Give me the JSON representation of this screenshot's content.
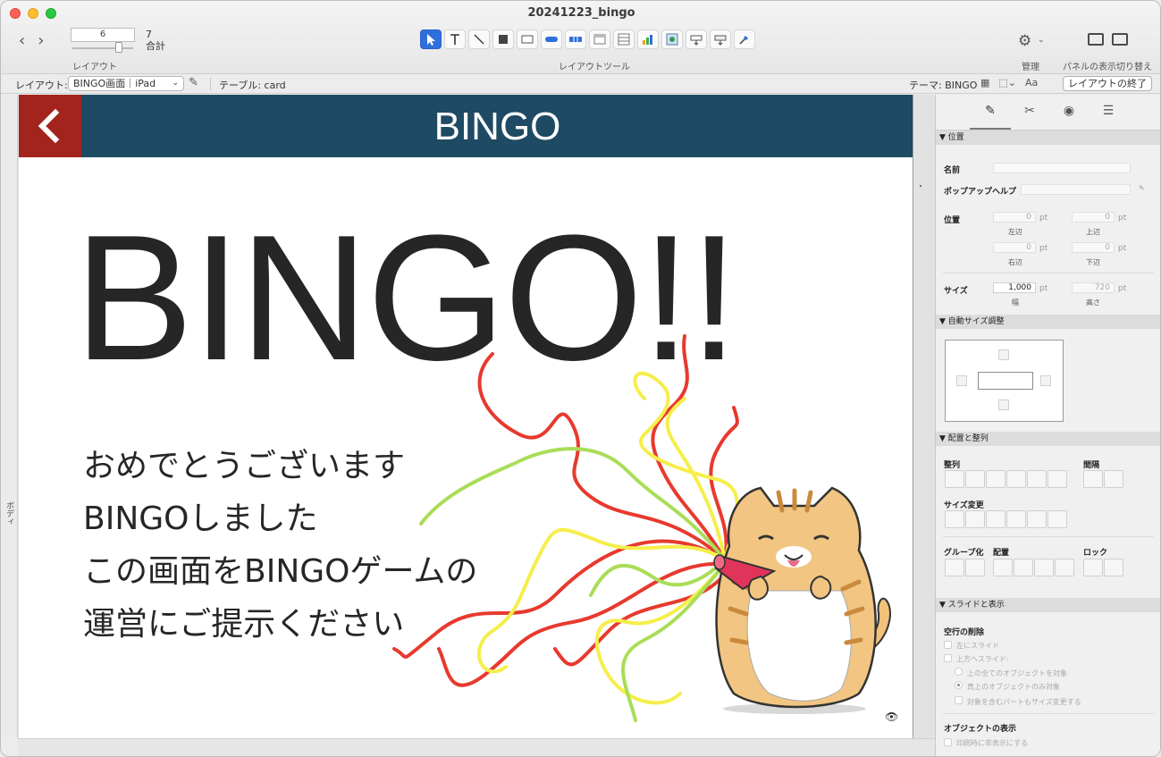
{
  "window": {
    "title": "20241223_bingo"
  },
  "toolbar": {
    "record_value": "6",
    "record_total": "7",
    "record_total_label": "合計",
    "layout_label": "レイアウト",
    "tools_label": "レイアウトツール",
    "manage_label": "管理",
    "panel_toggle_label": "パネルの表示切り替え",
    "tools": [
      "pointer-tool",
      "text-tool",
      "line-tool",
      "shape-tool",
      "field-tool",
      "button-tool",
      "button-bar-tool",
      "popover-tool",
      "portal-tool",
      "chart-tool",
      "web-viewer-tool",
      "insert-field-tool",
      "insert-part-tool",
      "format-painter-tool"
    ]
  },
  "layoutbar": {
    "layout_label": "レイアウト:",
    "layout_value": "BINGO画面｜iPad",
    "table_label": "テーブル: card",
    "theme_label": "テーマ: BINGO",
    "exit_button": "レイアウトの終了"
  },
  "canvas": {
    "body_part_label": "ボディ",
    "header_title": "BINGO",
    "big_text": "BINGO!!",
    "message_lines": [
      "おめでとうございます",
      "BINGOしました",
      "この画面をBINGOゲームの",
      "運営にご提示ください"
    ]
  },
  "colors": {
    "header_bg": "#1e4a64",
    "back_button_bg": "#a3241d",
    "streamer_red": "#e8392e",
    "streamer_yellow": "#f6ee4a",
    "streamer_green": "#a9dd57"
  },
  "inspector": {
    "tabs": [
      "position-tab",
      "appearance-tab",
      "data-tab",
      "styles-tab"
    ],
    "sections": {
      "position": "▼ 位置",
      "autosize": "▼ 自動サイズ調整",
      "arrange": "▼ 配置と整列",
      "sliding": "▼ スライドと表示"
    },
    "labels": {
      "name": "名前",
      "tooltip": "ポップアップヘルプ",
      "position": "位置",
      "left": "左辺",
      "top": "上辺",
      "right": "右辺",
      "bottom": "下辺",
      "size": "サイズ",
      "width": "幅",
      "height": "高さ",
      "align": "整列",
      "spacing": "間隔",
      "resize": "サイズ変更",
      "group": "グループ化",
      "arrange": "配置",
      "lock": "ロック",
      "remove_blank": "空行の削除",
      "slide_left": "左にスライド",
      "slide_up": "上方へスライド:",
      "all_above": "上の全てのオブジェクトを対象",
      "directly_above": "真上のオブジェクトのみ対象",
      "resize_enclosing": "対象を含むパートもサイズ変更する",
      "object_visibility": "オブジェクトの表示",
      "hide_when_printing": "印刷時に非表示にする"
    },
    "values": {
      "left": "0",
      "top": "0",
      "right": "0",
      "bottom": "0",
      "width": "1,000",
      "height": "720",
      "unit": "pt"
    }
  }
}
